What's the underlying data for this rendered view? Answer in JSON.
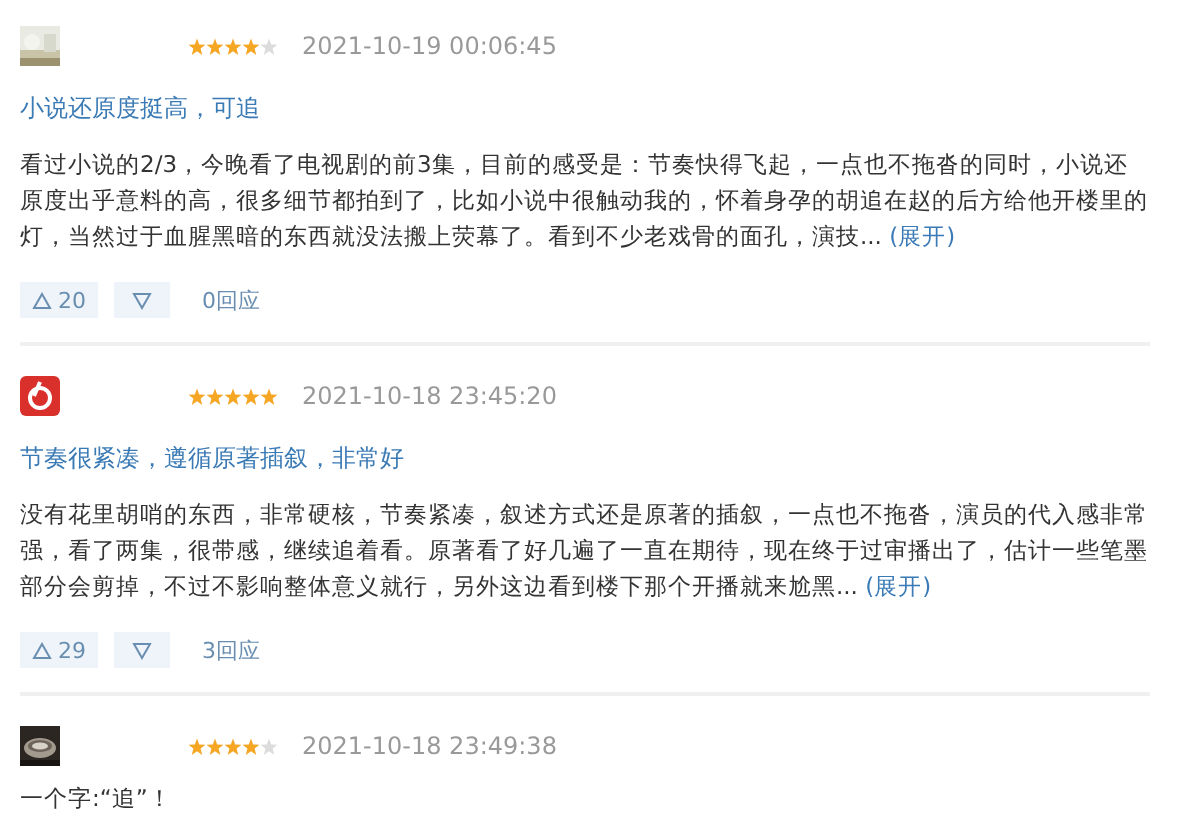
{
  "reviews": [
    {
      "stars": 4,
      "date": "2021-10-19 00:06:45",
      "title": "小说还原度挺高，可追",
      "body": "看过小说的2/3，今晚看了电视剧的前3集，目前的感受是：节奏快得飞起，一点也不拖沓的同时，小说还原度出乎意料的高，很多细节都拍到了，比如小说中很触动我的，怀着身孕的胡追在赵的后方给他开楼里的灯，当然过于血腥黑暗的东西就没法搬上荧幕了。看到不少老戏骨的面孔，演技...",
      "expand": "(展开)",
      "up": "20",
      "replies": "0回应"
    },
    {
      "avatar": {
        "kind": "app-icon"
      },
      "stars": 5,
      "date": "2021-10-18 23:45:20",
      "title": "节奏很紧凑，遵循原著插叙，非常好",
      "body": "没有花里胡哨的东西，非常硬核，节奏紧凑，叙述方式还是原著的插叙，一点也不拖沓，演员的代入感非常强，看了两集，很带感，继续追着看。原著看了好几遍了一直在期待，现在终于过审播出了，估计一些笔墨部分会剪掉，不过不影响整体意义就行，另外这边看到楼下那个开播就来尬黑...",
      "expand": "(展开)",
      "up": "29",
      "replies": "3回应"
    },
    {
      "stars": 4,
      "date": "2021-10-18 23:49:38",
      "body": "一个字:“追”！"
    }
  ]
}
